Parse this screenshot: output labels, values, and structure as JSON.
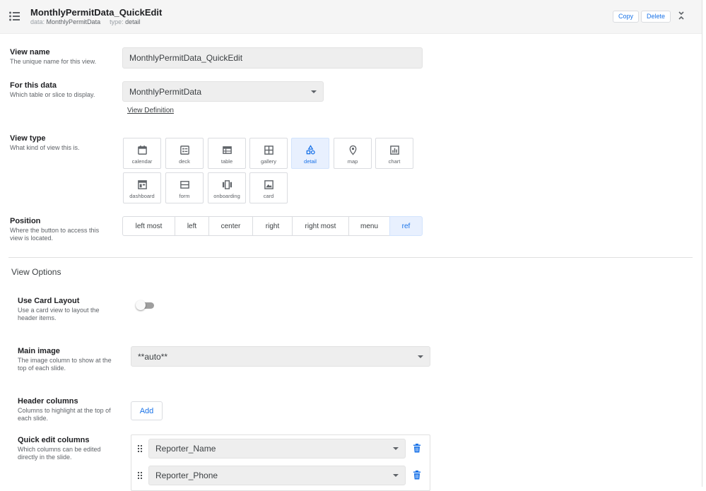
{
  "header": {
    "title": "MonthlyPermitData_QuickEdit",
    "data_label": "data:",
    "data_value": "MonthlyPermitData",
    "type_label": "type:",
    "type_value": "detail",
    "copy_label": "Copy",
    "delete_label": "Delete",
    "menu_icon": "list-icon",
    "collapse_icon": "collapse-icon"
  },
  "view_name": {
    "label": "View name",
    "description": "The unique name for this view.",
    "value": "MonthlyPermitData_QuickEdit"
  },
  "for_data": {
    "label": "For this data",
    "description": "Which table or slice to display.",
    "value": "MonthlyPermitData",
    "link": "View Definition"
  },
  "view_type": {
    "label": "View type",
    "description": "What kind of view this is.",
    "options": [
      {
        "label": "calendar",
        "icon": "calendar-icon"
      },
      {
        "label": "deck",
        "icon": "deck-icon"
      },
      {
        "label": "table",
        "icon": "table-icon"
      },
      {
        "label": "gallery",
        "icon": "gallery-icon"
      },
      {
        "label": "detail",
        "icon": "detail-icon",
        "selected": true
      },
      {
        "label": "map",
        "icon": "map-pin-icon"
      },
      {
        "label": "chart",
        "icon": "chart-icon"
      },
      {
        "label": "dashboard",
        "icon": "dashboard-icon"
      },
      {
        "label": "form",
        "icon": "form-icon"
      },
      {
        "label": "onboarding",
        "icon": "onboarding-icon"
      },
      {
        "label": "card",
        "icon": "card-icon"
      }
    ]
  },
  "position": {
    "label": "Position",
    "description_line1": "Where the button to access this",
    "description_line2": "view is located.",
    "options": [
      "left most",
      "left",
      "center",
      "right",
      "right most",
      "menu",
      "ref"
    ],
    "selected": "ref"
  },
  "view_options": {
    "title": "View Options",
    "card_layout": {
      "label": "Use Card Layout",
      "description_line1": "Use a card view to layout the",
      "description_line2": "header items.",
      "enabled": false
    },
    "main_image": {
      "label": "Main image",
      "description_line1": "The image column to show at the",
      "description_line2": "top of each slide.",
      "value": "**auto**"
    },
    "header_columns": {
      "label": "Header columns",
      "description_line1": "Columns to highlight at the top of",
      "description_line2": "each slide.",
      "add_label": "Add"
    },
    "quick_edit": {
      "label": "Quick edit columns",
      "description_line1": "Which columns can be edited",
      "description_line2": "directly in the slide.",
      "columns": [
        "Reporter_Name",
        "Reporter_Phone"
      ]
    }
  },
  "colors": {
    "accent": "#1a73e8",
    "selected_bg": "#e8f0fe",
    "field_bg": "#eeeeee",
    "header_bg": "#f5f5f5"
  }
}
